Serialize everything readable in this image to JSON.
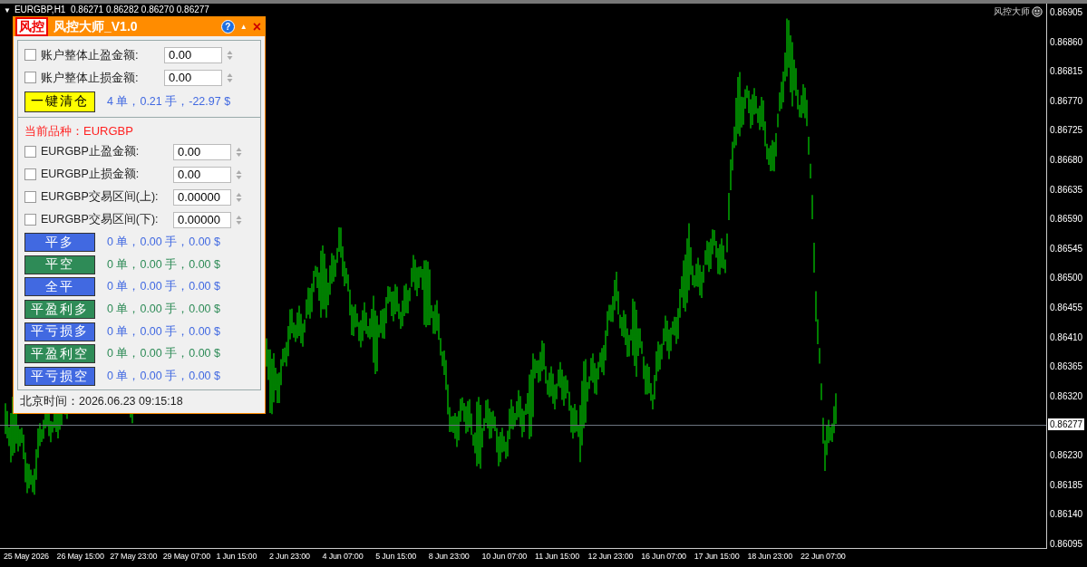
{
  "chart": {
    "menu_icon": "▼",
    "symbol_line": "EURGBP,H1  0.86271 0.86282 0.86270 0.86277",
    "corner_label": "风控大师",
    "current_price": "0.86277",
    "price_ticks_upper": [
      "0.86905",
      "0.86860",
      "0.86815",
      "0.86770",
      "0.86725",
      "0.86680",
      "0.86635",
      "0.86590",
      "0.86545",
      "0.86500",
      "0.86455",
      "0.86410",
      "0.86365",
      "0.86320"
    ],
    "price_ticks_lower": [
      "0.86230",
      "0.86185",
      "0.86140",
      "0.86095"
    ],
    "time_ticks": [
      "25 May 2026",
      "26 May 15:00",
      "27 May 23:00",
      "29 May 07:00",
      "1 Jun 15:00",
      "2 Jun 23:00",
      "4 Jun 07:00",
      "5 Jun 15:00",
      "8 Jun 23:00",
      "10 Jun 07:00",
      "11 Jun 15:00",
      "12 Jun 23:00",
      "16 Jun 07:00",
      "17 Jun 15:00",
      "18 Jun 23:00",
      "22 Jun 07:00"
    ]
  },
  "panel": {
    "logo": "风控",
    "title": "风控大师_V1.0",
    "help": "?",
    "minimize": "▲",
    "close": "×",
    "account_rows": [
      {
        "label": "账户整体止盈金额:",
        "value": "0.00",
        "checked": false
      },
      {
        "label": "账户整体止损金额:",
        "value": "0.00",
        "checked": false
      }
    ],
    "close_all": {
      "label": "一键清仓",
      "stats": "4 单，0.21 手，-22.97 $"
    },
    "symbol_label": "当前品种：EURGBP",
    "symbol_rows": [
      {
        "label": "EURGBP止盈金额:",
        "value": "0.00",
        "checked": false
      },
      {
        "label": "EURGBP止损金额:",
        "value": "0.00",
        "checked": false
      },
      {
        "label": "EURGBP交易区间(上):",
        "value": "0.00000",
        "checked": false
      },
      {
        "label": "EURGBP交易区间(下):",
        "value": "0.00000",
        "checked": false
      }
    ],
    "actions": [
      {
        "label": "平多",
        "stats": "0 单，0.00 手，0.00 $",
        "color": "#4169e1"
      },
      {
        "label": "平空",
        "stats": "0 单，0.00 手，0.00 $",
        "color": "#2e8b57"
      },
      {
        "label": "全平",
        "stats": "0 单，0.00 手，0.00 $",
        "color": "#4169e1"
      },
      {
        "label": "平盈利多",
        "stats": "0 单，0.00 手，0.00 $",
        "color": "#2e8b57"
      },
      {
        "label": "平亏损多",
        "stats": "0 单，0.00 手，0.00 $",
        "color": "#4169e1"
      },
      {
        "label": "平盈利空",
        "stats": "0 单，0.00 手，0.00 $",
        "color": "#2e8b57"
      },
      {
        "label": "平亏损空",
        "stats": "0 单，0.00 手，0.00 $",
        "color": "#4169e1"
      }
    ],
    "time": "北京时间：2026.06.23 09:15:18"
  }
}
